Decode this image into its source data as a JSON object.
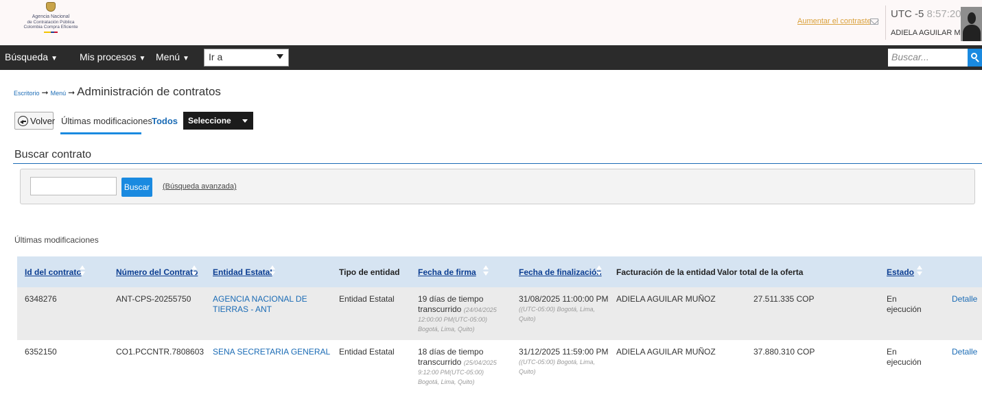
{
  "header": {
    "logo_line1": "Agencia Nacional",
    "logo_line2": "de Contratación Pública",
    "logo_line3": "Colombia Compra Eficiente",
    "contrast_link": "Aumentar el contraste",
    "timezone": "UTC -5",
    "time": "8:57:20",
    "username": "ADIELA AGUILAR M..."
  },
  "nav": {
    "search_menu": "Búsqueda",
    "processes_menu": "Mis procesos",
    "menu": "Menú",
    "goto_value": "Ir a",
    "search_placeholder": "Buscar..."
  },
  "breadcrumb": {
    "home": "Escritorio",
    "menu": "Menú",
    "title": "Administración de contratos"
  },
  "toolbar": {
    "back_label": "Volver",
    "tab_recent": "Últimas modificaciones",
    "tab_all": "Todos",
    "select_value": "Seleccione"
  },
  "search": {
    "title": "Buscar contrato",
    "button": "Buscar",
    "advanced_link": "(Búsqueda avanzada)"
  },
  "list_title": "Últimas modificaciones",
  "table": {
    "headers": {
      "id": "Id del contrato",
      "number": "Número del Contrato",
      "entity": "Entidad Estatal",
      "entity_type": "Tipo de entidad",
      "sign_date": "Fecha de firma",
      "end_date": "Fecha de finalización",
      "billing": "Facturación de la entidad",
      "value": "Valor total de la oferta",
      "status": "Estado"
    },
    "rows": [
      {
        "id": "6348276",
        "number": "ANT-CPS-20255750",
        "entity_line1": "AGENCIA NACIONAL DE",
        "entity_line2": "TIERRAS - ANT",
        "entity_type": "Entidad Estatal",
        "elapsed_line1": "19 días de tiempo",
        "elapsed_line2": "transcurrido",
        "sign_date_line1": "(24/04/2025",
        "sign_date_line2": "12:00:00 PM(UTC-05:00)",
        "sign_date_line3": "Bogotá, Lima, Quito)",
        "end_date": "31/08/2025 11:00:00 PM",
        "end_tz_line1": "((UTC-05:00) Bogotá, Lima,",
        "end_tz_line2": "Quito)",
        "billing": "ADIELA AGUILAR MUÑOZ",
        "value": "27.511.335 COP",
        "status_line1": "En",
        "status_line2": "ejecución",
        "detail": "Detalle"
      },
      {
        "id": "6352150",
        "number": "CO1.PCCNTR.7808603",
        "entity_line1": "SENA SECRETARIA GENERAL",
        "entity_line2": "",
        "entity_type": "Entidad Estatal",
        "elapsed_line1": "18 días de tiempo",
        "elapsed_line2": "transcurrido",
        "sign_date_line1": "(25/04/2025",
        "sign_date_line2": "9:12:00 PM(UTC-05:00)",
        "sign_date_line3": "Bogotá, Lima, Quito)",
        "end_date": "31/12/2025 11:59:00 PM",
        "end_tz_line1": "((UTC-05:00) Bogotá, Lima,",
        "end_tz_line2": "Quito)",
        "billing": "ADIELA AGUILAR MUÑOZ",
        "value": "37.880.310 COP",
        "status_line1": "En",
        "status_line2": "ejecución",
        "detail": "Detalle"
      }
    ]
  },
  "colors": {
    "accent": "#1a8ae0",
    "navbar": "#2b2b2b",
    "link": "#1a6bb5",
    "table_header": "#d6e4f2"
  }
}
